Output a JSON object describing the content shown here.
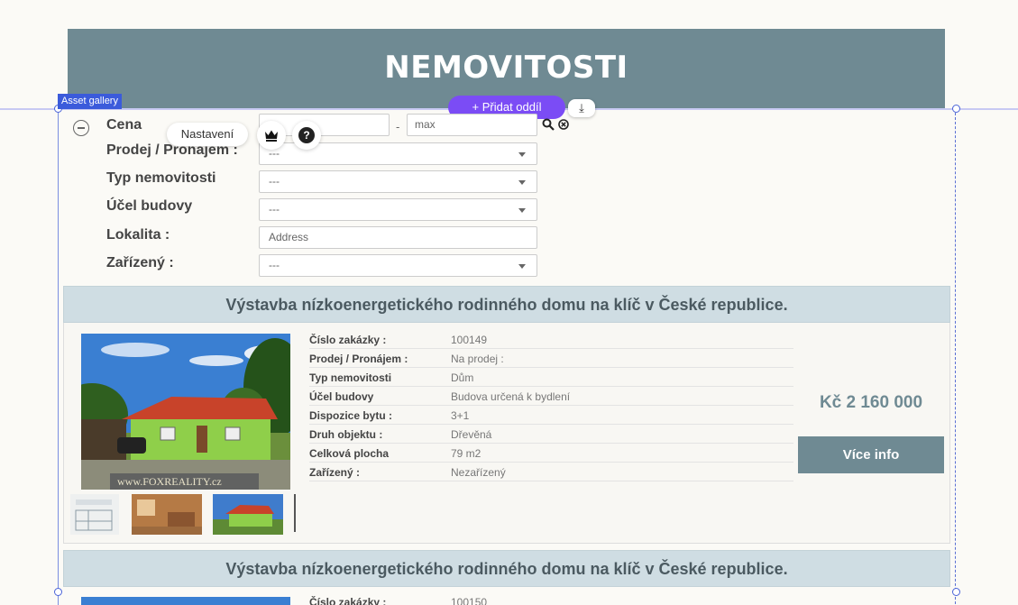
{
  "header": {
    "title": "NEMOVITOSTI"
  },
  "editor": {
    "asset_tag": "Asset gallery",
    "add_section": "+ Přidat oddíl",
    "download_icon": "download-icon",
    "settings": "Nastavení",
    "help": "?"
  },
  "filter": {
    "price_label": "Cena",
    "price_min_placeholder": "",
    "price_max_placeholder": "max",
    "price_dash": "-",
    "sale_label": "Prodej / Pronájem :",
    "sale_value": "---",
    "type_label": "Typ nemovitosti",
    "type_value": "---",
    "purpose_label": "Účel budovy",
    "purpose_value": "---",
    "location_label": "Lokalita :",
    "location_placeholder": "Address",
    "furnished_label": "Zařízený :",
    "furnished_value": "---"
  },
  "listings": [
    {
      "title": "Výstavba nízkoenergetického rodinného domu na klíč v České republice.",
      "watermark": "www.FOXREALITY.cz",
      "details": [
        {
          "k": "Číslo zakázky :",
          "v": "100149"
        },
        {
          "k": "Prodej / Pronájem :",
          "v": "Na prodej :"
        },
        {
          "k": "Typ nemovitosti",
          "v": "Dům"
        },
        {
          "k": "Účel budovy",
          "v": "Budova určená k bydlení"
        },
        {
          "k": "Dispozice bytu :",
          "v": "3+1"
        },
        {
          "k": "Druh objektu :",
          "v": "Dřevěná"
        },
        {
          "k": "Celková plocha",
          "v": "79 m2"
        },
        {
          "k": "Zařízený :",
          "v": "Nezařízený"
        }
      ],
      "price": "Kč 2 160 000",
      "more": "Více info"
    },
    {
      "title": "Výstavba nízkoenergetického rodinného domu na klíč v České republice.",
      "details": [
        {
          "k": "Číslo zakázky :",
          "v": "100150"
        }
      ]
    }
  ],
  "colors": {
    "header": "#6f8a93",
    "accent": "#7b4cf5",
    "selection": "#3b5bdb"
  }
}
